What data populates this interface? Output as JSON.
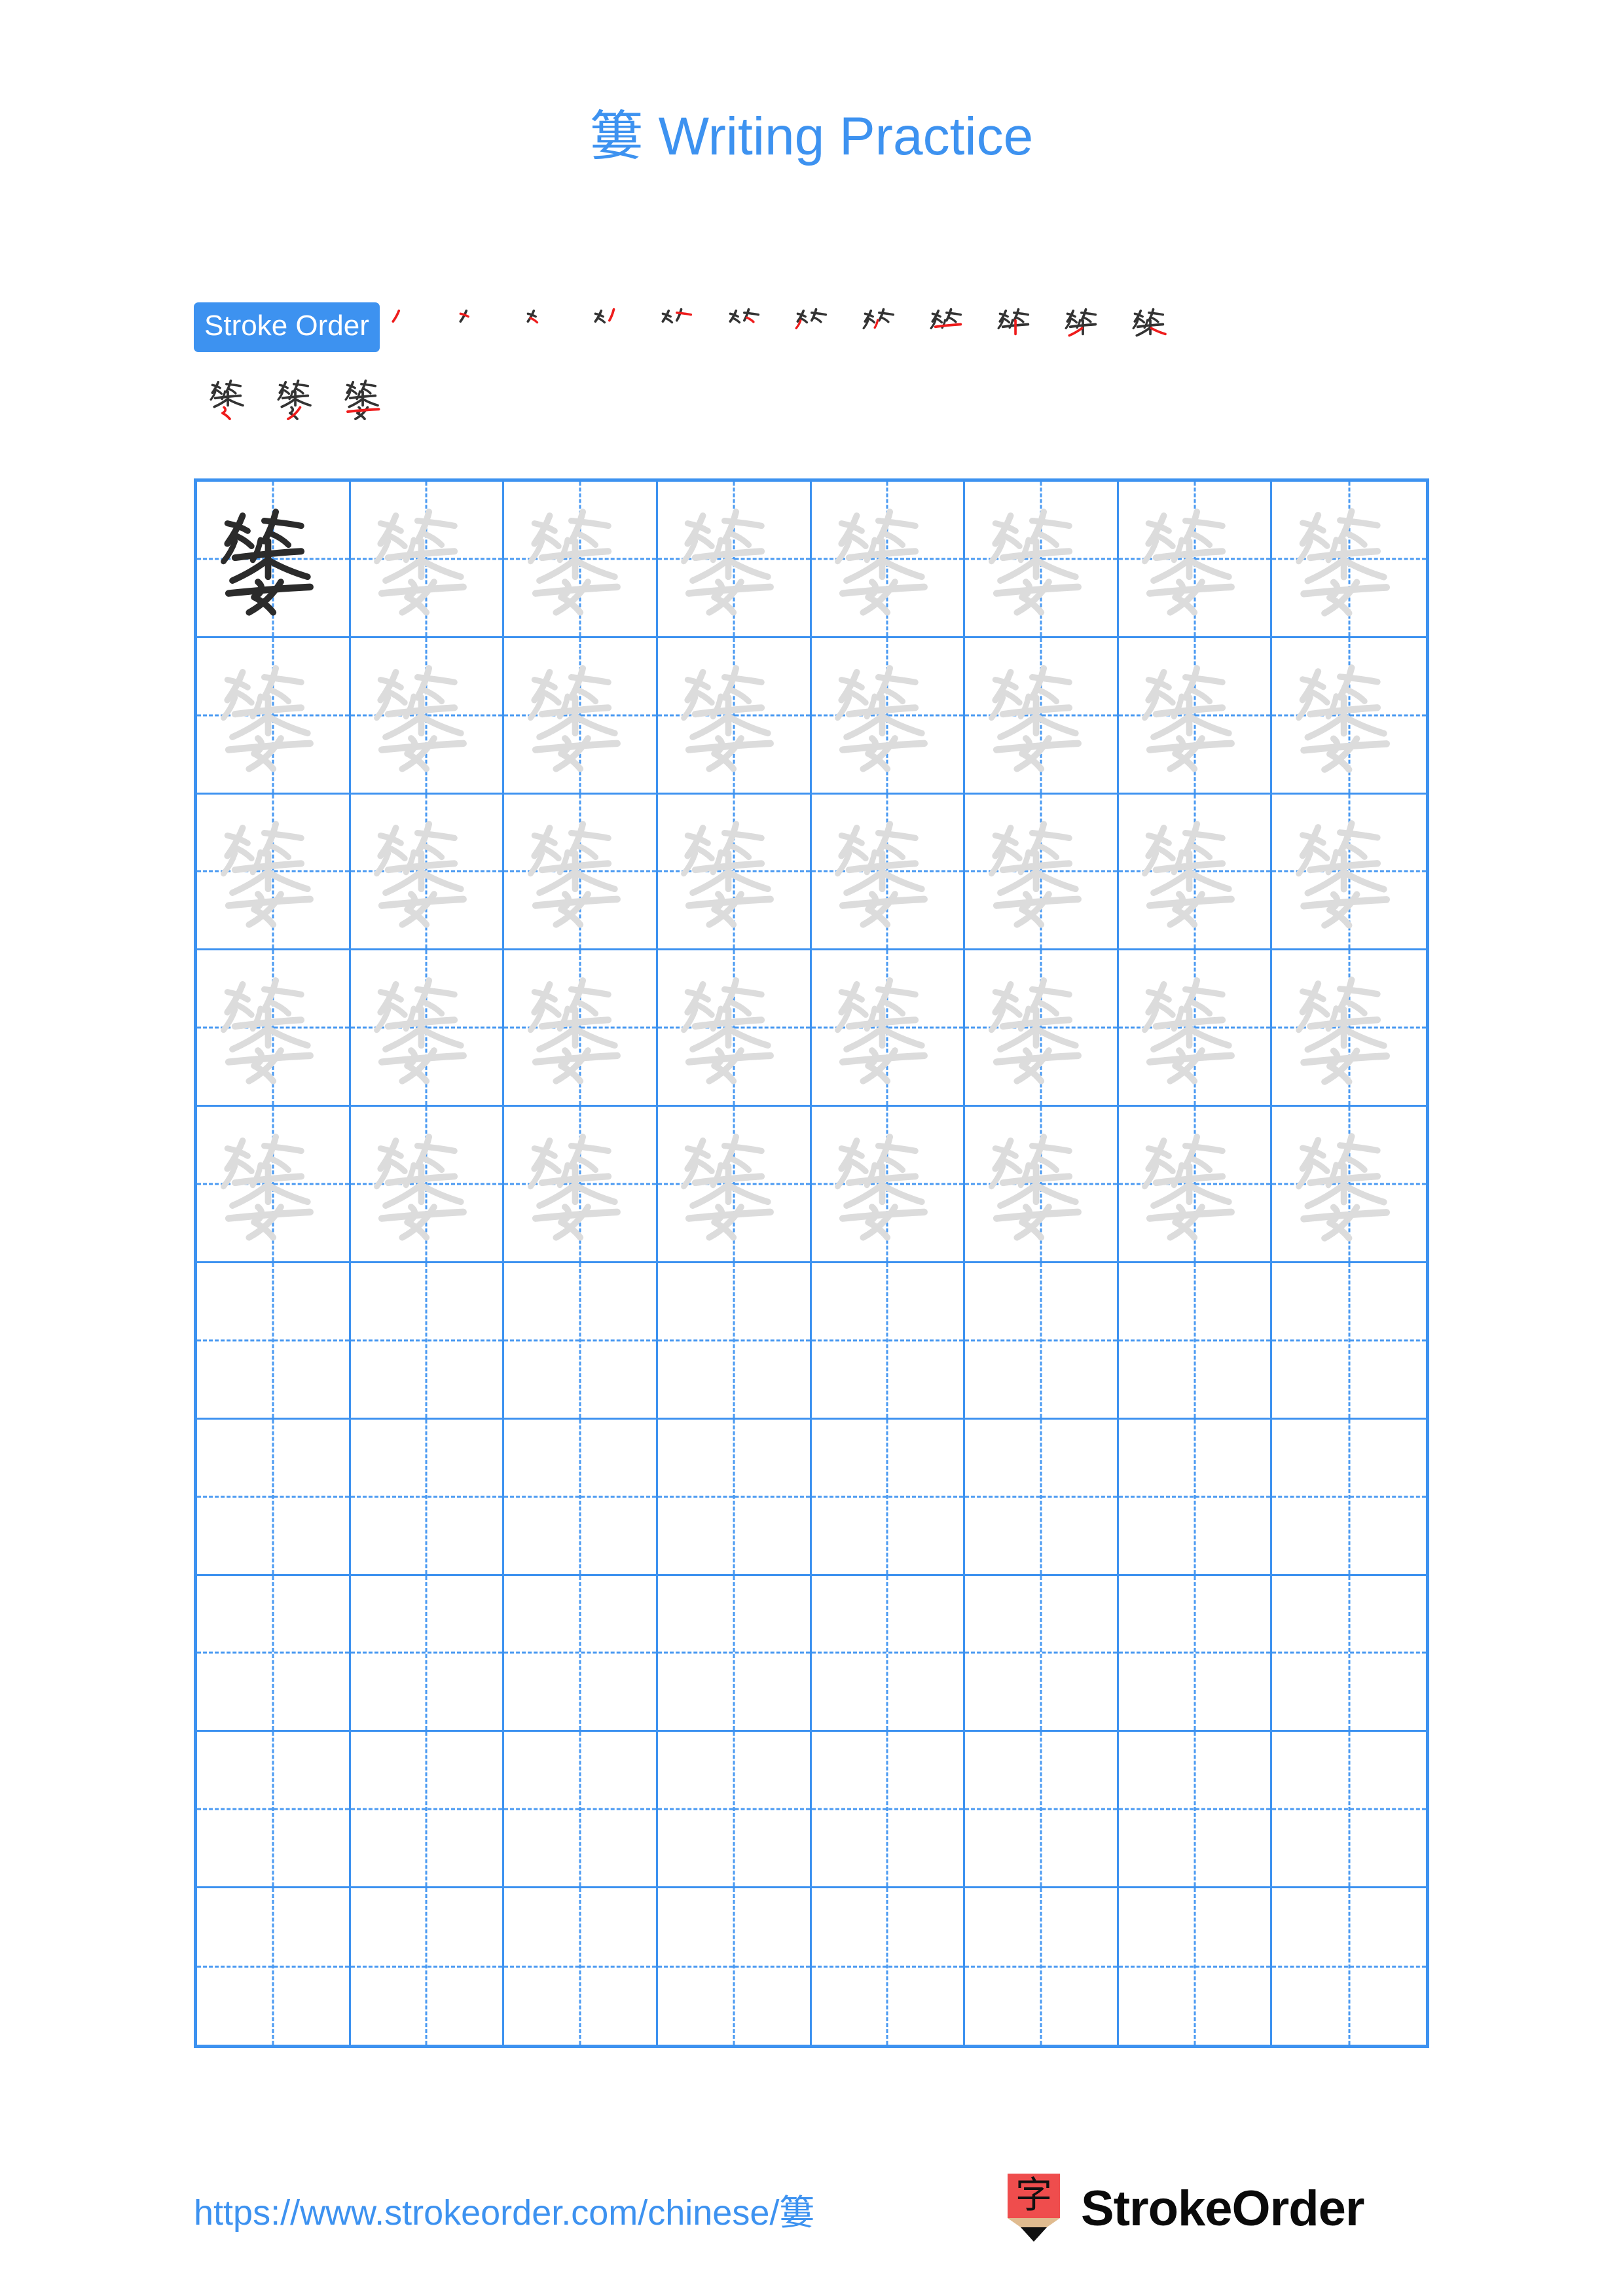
{
  "page": {
    "character": "簍",
    "title_suffix": " Writing Practice",
    "background_color": "#ffffff",
    "accent_color": "#3d92f0",
    "stroke_new_color": "#ee1c1c",
    "stroke_done_color": "#333333",
    "trace_glyph_color": "#dcdcdc",
    "solid_glyph_color": "#2b2b2b"
  },
  "title": {
    "full": "簍 Writing Practice"
  },
  "stroke_order": {
    "badge_label": "Stroke Order",
    "total_strokes": 15,
    "row1_count": 12,
    "row2_count": 3,
    "steps": [
      {
        "index": 1,
        "partial": "丿"
      },
      {
        "index": 2,
        "partial": "𠂉"
      },
      {
        "index": 3,
        "partial": "𠂈"
      },
      {
        "index": 4,
        "partial": "𠂉丿"
      },
      {
        "index": 5,
        "partial": "𥫗"
      },
      {
        "index": 6,
        "partial": "𥫗"
      },
      {
        "index": 7,
        "partial": "竹"
      },
      {
        "index": 8,
        "partial": "竹"
      },
      {
        "index": 9,
        "partial": "竺"
      },
      {
        "index": 10,
        "partial": "竿"
      },
      {
        "index": 11,
        "partial": "笨"
      },
      {
        "index": 12,
        "partial": "策"
      },
      {
        "index": 13,
        "partial": "簍"
      },
      {
        "index": 14,
        "partial": "簍"
      },
      {
        "index": 15,
        "partial": "簍"
      }
    ]
  },
  "practice_grid": {
    "columns": 8,
    "rows": 10,
    "solid_cells": 1,
    "trace_rows": 5,
    "blank_rows": 5,
    "cell_character": "簍",
    "grid_line_color": "#3d92f0",
    "guide_line_color": "#4a9af2"
  },
  "footer": {
    "url": "https://www.strokeorder.com/chinese/簍",
    "brand_name": "StrokeOrder",
    "logo_character": "字",
    "logo_body_color": "#ef4d4d",
    "logo_wood_color": "#e0bb8f",
    "logo_tip_color": "#111111"
  }
}
